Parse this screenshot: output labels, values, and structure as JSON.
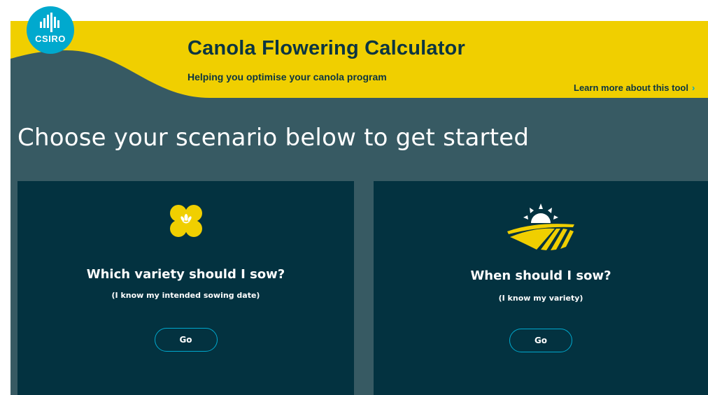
{
  "brand": {
    "logo_text": "CSIRO",
    "logo_color": "#00a9ce",
    "banner_color": "#f0cf00",
    "text_dark": "#0b3542"
  },
  "header": {
    "title": "Canola Flowering Calculator",
    "subtitle": "Helping you optimise your canola program",
    "learn_more_label": "Learn more about this tool",
    "learn_more_icon": "chevron-right-icon"
  },
  "main": {
    "heading": "Choose your scenario below to get started",
    "background_color": "#375a63",
    "card_color": "#033240",
    "accent_color": "#f0cf00",
    "cards": [
      {
        "icon": "canola-flower-icon",
        "title": "Which variety should I sow?",
        "subtitle": "(I know my intended sowing date)",
        "button_label": "Go"
      },
      {
        "icon": "sunrise-field-icon",
        "title": "When should I sow?",
        "subtitle": "(I know my variety)",
        "button_label": "Go"
      }
    ]
  }
}
